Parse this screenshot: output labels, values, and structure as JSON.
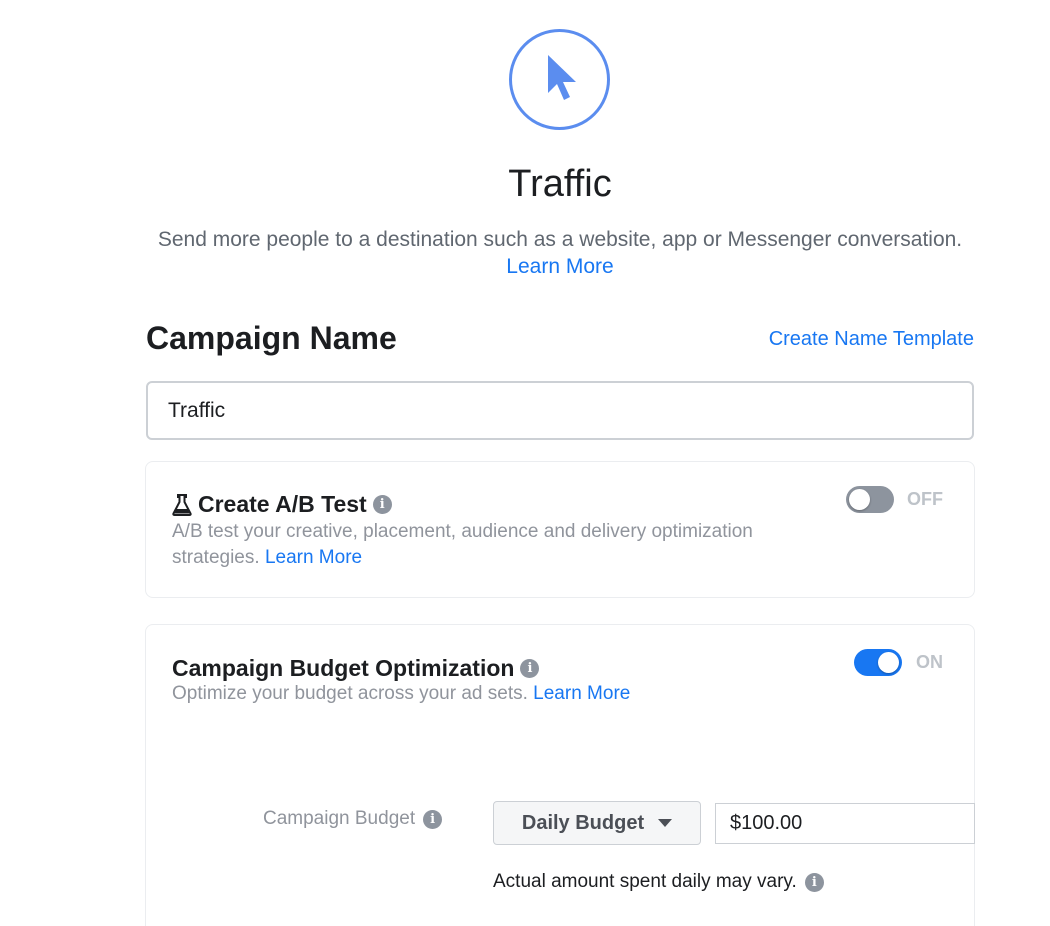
{
  "header": {
    "icon": "cursor-pointer-icon",
    "title": "Traffic",
    "description": "Send more people to a destination such as a website, app or Messenger conversation.",
    "learn_more": "Learn More"
  },
  "campaign_name": {
    "heading": "Campaign Name",
    "create_template": "Create Name Template",
    "value": "Traffic"
  },
  "ab_test": {
    "icon": "flask-icon",
    "title": "Create A/B Test",
    "description": "A/B test your creative, placement, audience and delivery optimization strategies.",
    "learn_more": "Learn More",
    "toggle_state": "OFF"
  },
  "cbo": {
    "title": "Campaign Budget Optimization",
    "description": "Optimize your budget across your ad sets.",
    "learn_more": "Learn More",
    "toggle_state": "ON",
    "budget_label": "Campaign Budget",
    "budget_type": "Daily Budget",
    "budget_amount": "$100.00",
    "note": "Actual amount spent daily may vary."
  },
  "colors": {
    "accent": "#1877f2",
    "icon_ring": "#5b8def",
    "text_primary": "#1c1e21",
    "text_secondary": "#90949c"
  }
}
